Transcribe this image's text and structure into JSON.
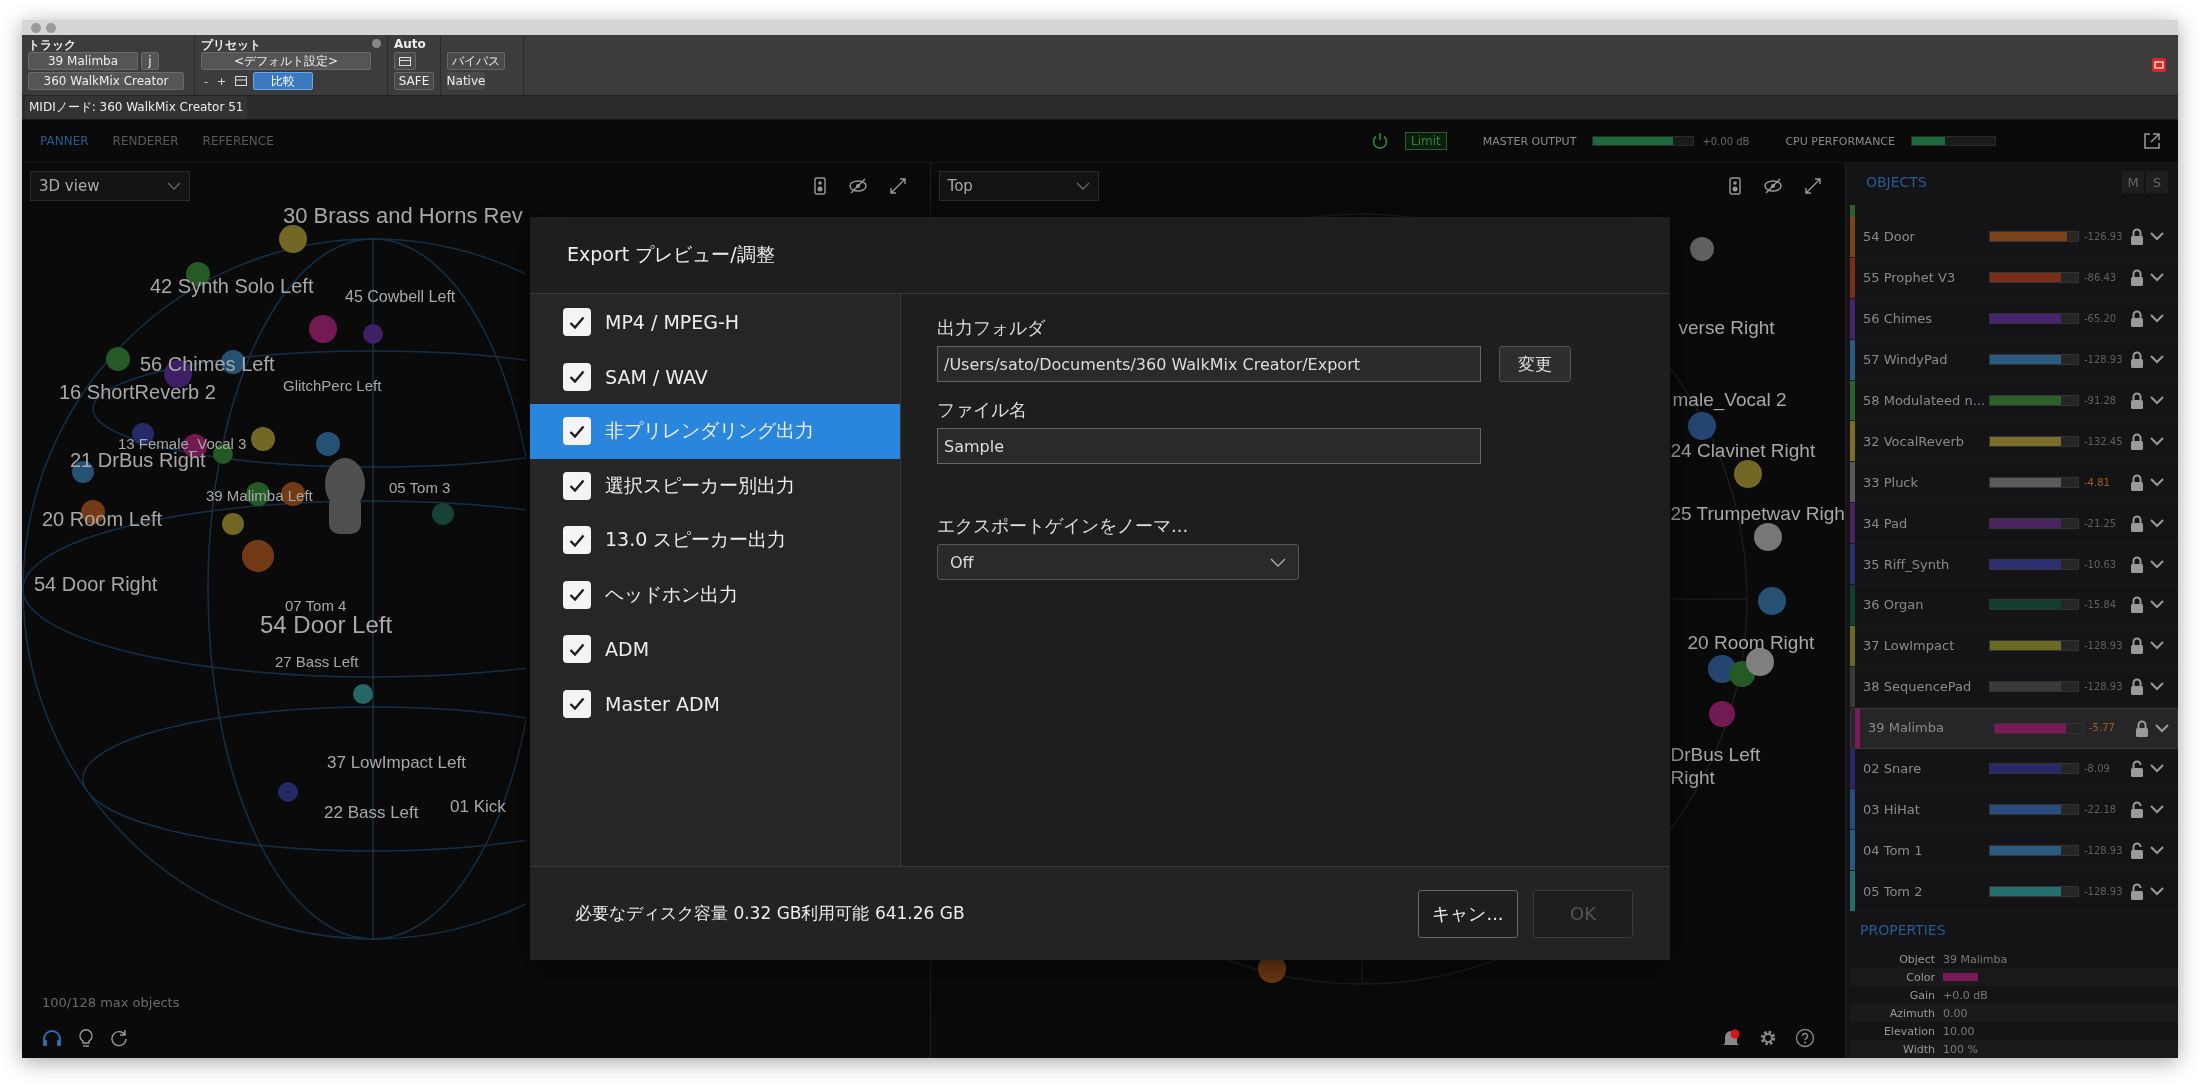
{
  "toolbar": {
    "track_label": "トラック",
    "track": "39 Malimba",
    "track_key": "j",
    "plugin": "360 WalkMix Creator",
    "preset_label": "プリセット",
    "preset": "<デフォルト設定>",
    "preset_minus": "-",
    "preset_plus": "+",
    "compare": {
      "label": "比較",
      "on": true
    },
    "auto_label": "Auto",
    "safe": "SAFE",
    "bypass": "バイパス",
    "native": "Native"
  },
  "midi_node": "MIDIノード: 360 WalkMix Creator 51",
  "tabs": [
    {
      "label": "PANNER",
      "selected": true
    },
    {
      "label": "RENDERER",
      "selected": false
    },
    {
      "label": "REFERENCE",
      "selected": false
    }
  ],
  "status": {
    "limit": {
      "label": "Limit",
      "on": true
    },
    "master_output": {
      "label": "MASTER OUTPUT",
      "level": 0.8,
      "reading": "+0.00 dB"
    },
    "cpu": {
      "label": "CPU PERFORMANCE",
      "level": 0.4
    }
  },
  "left_view": {
    "view_select": "3D view",
    "labels": [
      "30 Brass and Horns Rev",
      "42 Synth Solo Left",
      "45 Cowbell Left",
      "56 Chimes Left",
      "16 ShortReverb 2",
      "GlitchPerc Left",
      "13 Female_Vocal 3",
      "21 DrBus Right",
      "39 Malimba Left",
      "20 Room Left",
      "54 Door Right",
      "07 Tom 4",
      "05 Tom 3",
      "54 Door Left",
      "27 Bass Left",
      "37 LowImpact Left",
      "22 Bass Left",
      "01 Kick"
    ],
    "objects_count": "100/128 max objects"
  },
  "right_view": {
    "view_select": "Top",
    "labels": [
      "verse Right",
      "male_Vocal 2",
      "24 Clavinet Right",
      "25 Trumpetwav Righ",
      "20 Room Right",
      "DrBus Left",
      "Right"
    ]
  },
  "notifications": {
    "unread": true
  },
  "objects": {
    "title": "OBJECTS",
    "mute": "M",
    "solo": "S",
    "items": [
      {
        "name": "54 Door",
        "color": "#7a4418",
        "level": 0.87,
        "reading": "-126.93",
        "hot": false,
        "locked": true,
        "selected": false
      },
      {
        "name": "55 Prophet V3",
        "color": "#7a3018",
        "level": 0.81,
        "reading": "-86.43",
        "hot": false,
        "locked": true,
        "selected": false
      },
      {
        "name": "56 Chimes",
        "color": "#46256e",
        "level": 0.81,
        "reading": "-65.20",
        "hot": false,
        "locked": true,
        "selected": false
      },
      {
        "name": "57 WindyPad",
        "color": "#2a5a80",
        "level": 0.81,
        "reading": "-128.93",
        "hot": false,
        "locked": true,
        "selected": false
      },
      {
        "name": "58 Modulateed n...",
        "color": "#2e602e",
        "level": 0.81,
        "reading": "-91.28",
        "hot": false,
        "locked": true,
        "selected": false
      },
      {
        "name": "32 VocalReverb",
        "color": "#7a6e28",
        "level": 0.81,
        "reading": "-132.45",
        "hot": false,
        "locked": true,
        "selected": false
      },
      {
        "name": "33 Pluck",
        "color": "#5a5a5a",
        "level": 0.81,
        "reading": "-4.81",
        "hot": true,
        "locked": true,
        "selected": false
      },
      {
        "name": "34 Pad",
        "color": "#4a2460",
        "level": 0.81,
        "reading": "-21.25",
        "hot": false,
        "locked": true,
        "selected": false
      },
      {
        "name": "35 Riff_Synth",
        "color": "#2a3070",
        "level": 0.81,
        "reading": "-10.63",
        "hot": false,
        "locked": true,
        "selected": false
      },
      {
        "name": "36 Organ",
        "color": "#153e33",
        "level": 0.81,
        "reading": "-15.84",
        "hot": false,
        "locked": true,
        "selected": false
      },
      {
        "name": "37 LowImpact",
        "color": "#6a6a22",
        "level": 0.81,
        "reading": "-128.93",
        "hot": false,
        "locked": true,
        "selected": false
      },
      {
        "name": "38 SequencePad",
        "color": "#3a3a3a",
        "level": 0.81,
        "reading": "-128.93",
        "hot": false,
        "locked": true,
        "selected": false
      },
      {
        "name": "39 Malimba",
        "color": "#7a1a58",
        "level": 0.81,
        "reading": "-5.77",
        "hot": true,
        "locked": true,
        "selected": true
      },
      {
        "name": "02 Snare",
        "color": "#2a2868",
        "level": 0.81,
        "reading": "-8.09",
        "hot": false,
        "locked": false,
        "selected": false
      },
      {
        "name": "03 HiHat",
        "color": "#284c80",
        "level": 0.81,
        "reading": "-22.18",
        "hot": false,
        "locked": false,
        "selected": false
      },
      {
        "name": "04 Tom  1",
        "color": "#2a5a80",
        "level": 0.81,
        "reading": "-128.93",
        "hot": false,
        "locked": false,
        "selected": false
      },
      {
        "name": "05 Tom  2",
        "color": "#256e6e",
        "level": 0.81,
        "reading": "-128.93",
        "hot": false,
        "locked": false,
        "selected": false
      }
    ]
  },
  "properties": {
    "title": "PROPERTIES",
    "items": [
      {
        "label": "Object",
        "kind": "text",
        "value": "39 Malimba"
      },
      {
        "label": "Color",
        "kind": "swatch",
        "color": "#7a1a58"
      },
      {
        "label": "Gain",
        "kind": "text",
        "value": "+0.0 dB"
      },
      {
        "label": "Azimuth",
        "kind": "text",
        "value": "0.00"
      },
      {
        "label": "Elevation",
        "kind": "text",
        "value": "10.00"
      },
      {
        "label": "Width",
        "kind": "text",
        "value": "100 %"
      }
    ]
  },
  "dialog": {
    "title": "Export プレビュー/調整",
    "options": [
      {
        "label": "MP4 / MPEG-H",
        "checked": true,
        "selected": false
      },
      {
        "label": "SAM / WAV",
        "checked": true,
        "selected": false
      },
      {
        "label": "非プリレンダリング出力",
        "checked": true,
        "selected": true
      },
      {
        "label": "選択スピーカー別出力",
        "checked": true,
        "selected": false
      },
      {
        "label": "13.0 スピーカー出力",
        "checked": true,
        "selected": false
      },
      {
        "label": "ヘッドホン出力",
        "checked": true,
        "selected": false
      },
      {
        "label": "ADM",
        "checked": true,
        "selected": false
      },
      {
        "label": "Master ADM",
        "checked": true,
        "selected": false
      }
    ],
    "output_folder_label": "出力フォルダ",
    "output_folder": "/Users/sato/Documents/360 WalkMix Creator/Export",
    "change_button": "変更",
    "file_name_label": "ファイル名",
    "file_name": "Sample",
    "normalize_label": "エクスポートゲインをノーマ...",
    "normalize": "Off",
    "disk_info": "必要なディスク容量 0.32 GB利用可能 641.26 GB",
    "cancel_button": "キャン...",
    "ok_button": {
      "label": "OK",
      "disabled": true
    }
  }
}
